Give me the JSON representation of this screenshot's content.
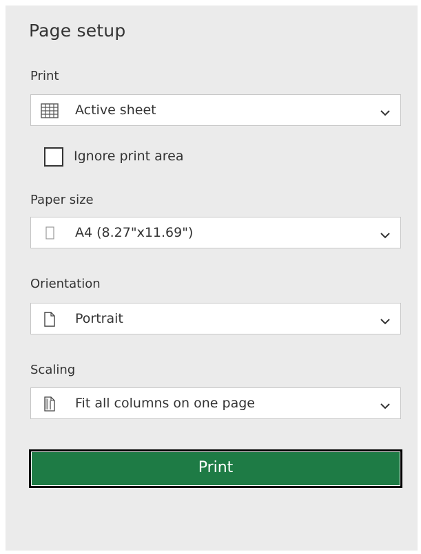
{
  "title": "Page setup",
  "print": {
    "label": "Print",
    "selected": "Active sheet",
    "icon": "sheet-grid-icon"
  },
  "ignore_print_area": {
    "label": "Ignore print area",
    "checked": false
  },
  "paper_size": {
    "label": "Paper size",
    "selected": "A4 (8.27\"x11.69\")",
    "icon": "paper-icon"
  },
  "orientation": {
    "label": "Orientation",
    "selected": "Portrait",
    "icon": "portrait-page-icon"
  },
  "scaling": {
    "label": "Scaling",
    "selected": "Fit all columns on one page",
    "icon": "fit-columns-icon"
  },
  "print_button": {
    "label": "Print"
  },
  "colors": {
    "panel_bg": "#ebebeb",
    "button_green": "#1e7b45"
  }
}
